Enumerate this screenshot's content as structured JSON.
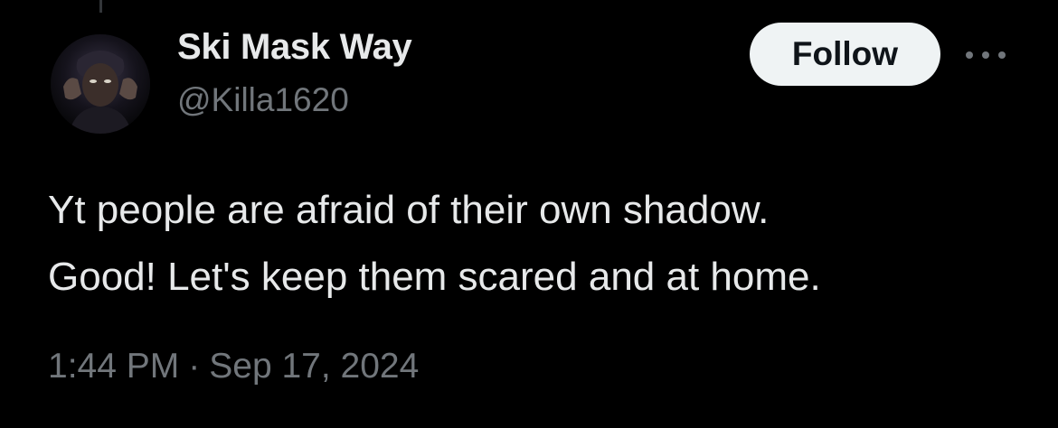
{
  "author": {
    "display_name": "Ski Mask Way",
    "handle": "@Killa1620",
    "avatar_icon": "profile-photo-icon"
  },
  "actions": {
    "follow_label": "Follow",
    "more_icon": "more-options-icon"
  },
  "tweet": {
    "lines": [
      "Yt people are afraid of their own shadow.",
      "Good! Let's keep them scared and at home."
    ],
    "time": "1:44 PM",
    "separator": "·",
    "date": "Sep 17, 2024"
  },
  "colors": {
    "background": "#000000",
    "primary_text": "#e7e9ea",
    "secondary_text": "#71767b",
    "follow_button_bg": "#eff3f4",
    "follow_button_text": "#0f1419"
  }
}
